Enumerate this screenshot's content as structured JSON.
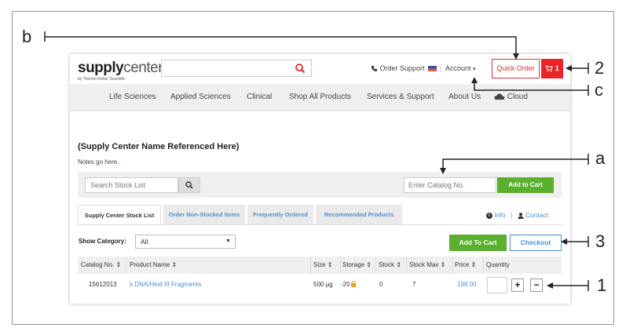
{
  "header": {
    "logo_bold": "supply",
    "logo_light": "center",
    "logo_sub": "by Thermo Fisher Scientific",
    "search_value": "",
    "order_support": "Order Support",
    "account": "Account",
    "account_caret": "▾",
    "quick_order": "Quick Order",
    "cart_count": "1"
  },
  "nav": [
    "Life Sciences",
    "Applied Sciences",
    "Clinical",
    "Shop All Products",
    "Services & Support",
    "About Us",
    "Cloud"
  ],
  "page": {
    "title": "(Supply Center Name Referenced Here)",
    "notes": "Notes go here.."
  },
  "stock_bar": {
    "search_placeholder": "Search Stock List",
    "catalog_placeholder": "Enter Catalog No.",
    "add_to_cart": "Add to Cart"
  },
  "tabs": [
    "Supply Center Stock List",
    "Order Non-Stocked Items",
    "Frequently Ordered",
    "Recommended Products"
  ],
  "links": {
    "info": "Info",
    "divider": "|",
    "contact": "Contact"
  },
  "filter": {
    "label": "Show Category:",
    "selected": "All",
    "add_to_cart": "Add To Cart",
    "checkout": "Checkout"
  },
  "table": {
    "sort_glyph": "⇕",
    "headers": [
      "Catalog No.",
      "Product Name",
      "Size",
      "Storage",
      "Stock",
      "Stock Max",
      "Price",
      "Quantity"
    ],
    "rows": [
      {
        "catalog": "15612013",
        "product": "λ DNA/Hind III Fragments",
        "size": "500 µg",
        "storage": "-20",
        "stock": "0",
        "stock_max": "7",
        "price": "199.00",
        "quantity": ""
      }
    ],
    "plus": "+",
    "minus": "−"
  },
  "annotations": {
    "b": "b",
    "two": "2",
    "c": "c",
    "a": "a",
    "three": "3",
    "one": "1"
  },
  "colors": {
    "accent_green": "#5cb02f",
    "accent_red": "#e8262a",
    "link_blue": "#4a8fd0"
  }
}
